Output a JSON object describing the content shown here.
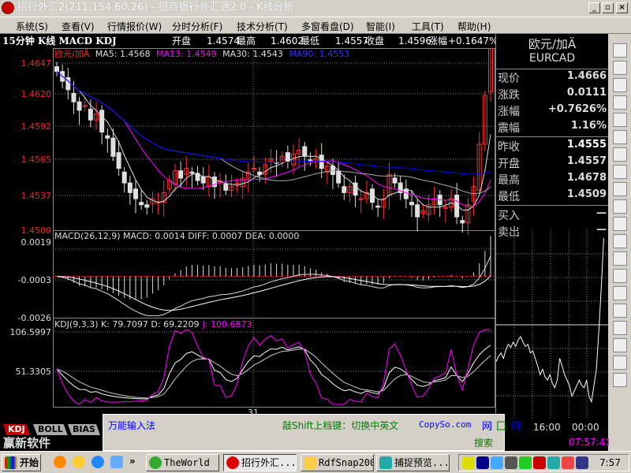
{
  "window": {
    "title": "招行外汇2(211.154.60.26) - 招商银行外汇通2.0 - K线分析",
    "min": "_",
    "restore": "▫",
    "close": "×"
  },
  "menu": [
    "系统(S)",
    "查看(V)",
    "行情报价(W)",
    "分时分析(F)",
    "技术分析(T)",
    "多窗看盘(D)",
    "智能(I)",
    "工具(T)",
    "帮助(H)"
  ],
  "info": {
    "title": "15分钟 K线 MACD KDJ",
    "open_label": "开盘",
    "open": "1.4574",
    "high_label": "最高",
    "high": "1.4602",
    "low_label": "最低",
    "low": "1.4557",
    "close_label": "收盘",
    "close": "1.4596",
    "chg_label": "涨幅",
    "chg": "+0.1647%"
  },
  "price_chart": {
    "name": "欧元/加Ä",
    "ma5": "MA5: 1.4568",
    "ma13": "MA13: 1.4549",
    "ma30": "MA30: 1.4543",
    "ma90": "MA90: 1.4553",
    "y_labels": [
      "1.4647",
      "1.4620",
      "1.4592",
      "1.4565",
      "1.4537",
      "1.4509"
    ],
    "ylim": [
      1.4509,
      1.4647
    ]
  },
  "macd": {
    "header": "MACD(26,12,9) MACD: 0.0014 DIFF: 0.0007 DEA: 0.0000",
    "y_labels": [
      "0.0019",
      "-0.0003",
      "-0.0026"
    ],
    "ylim": [
      -0.0026,
      0.0019
    ]
  },
  "kdj": {
    "header_k": "KDJ(9,3,3) K: 79.7097 D: 69.2209",
    "header_j": "J: 100.6873",
    "y_labels": [
      "106.5997",
      "51.3305"
    ]
  },
  "x_label": "31",
  "closes": [
    1.464,
    1.4632,
    1.4625,
    1.4615,
    1.4608,
    1.4612,
    1.46,
    1.4605,
    1.459,
    1.4585,
    1.457,
    1.456,
    1.4548,
    1.454,
    1.4535,
    1.453,
    1.4528,
    1.4535,
    1.4532,
    1.454,
    1.455,
    1.4558,
    1.4552,
    1.456,
    1.4556,
    1.455,
    1.4548,
    1.4553,
    1.4545,
    1.455,
    1.4542,
    1.4545,
    1.4548,
    1.4552,
    1.4557,
    1.456,
    1.4555,
    1.4563,
    1.4568,
    1.4565,
    1.457,
    1.4566,
    1.4572,
    1.4575,
    1.457,
    1.4566,
    1.4568,
    1.456,
    1.4562,
    1.4555,
    1.4548,
    1.454,
    1.4545,
    1.4538,
    1.4535,
    1.454,
    1.4532,
    1.4528,
    1.4535,
    1.4555,
    1.4548,
    1.454,
    1.4535,
    1.453,
    1.452,
    1.4525,
    1.453,
    1.4535,
    1.453,
    1.4528,
    1.4535,
    1.452,
    1.4515,
    1.453,
    1.4545,
    1.458,
    1.462,
    1.4666
  ],
  "quote": {
    "name": "欧元/加Ä",
    "code": "EURCAD",
    "rows": [
      {
        "l": "现价",
        "v": "1.4666"
      },
      {
        "l": "涨跌",
        "v": "0.0111"
      },
      {
        "l": "涨幅",
        "v": "+0.7626%"
      },
      {
        "l": "震幅",
        "v": "1.16%"
      },
      {
        "l": "昨收",
        "v": "1.4555"
      },
      {
        "l": "开盘",
        "v": "1.4557"
      },
      {
        "l": "最高",
        "v": "1.4678"
      },
      {
        "l": "最低",
        "v": "1.4509"
      },
      {
        "l": "买入",
        "v": "—"
      },
      {
        "l": "卖出",
        "v": "—"
      }
    ],
    "times": [
      "16:00",
      "00:00"
    ],
    "clock": "07:57:41"
  },
  "tabs": [
    "KDJ",
    "BOLL",
    "BIAS"
  ],
  "brand": "赢新软件",
  "ime": {
    "name": "万能输入法",
    "hint": "敲Shift上档键：切换中英文",
    "site": "CopySo.com",
    "b1": "网",
    "b2": "囗",
    "b3": "词",
    "search": "搜索"
  },
  "taskbar": {
    "start": "开始",
    "more": "»",
    "tasks": [
      "TheWorld",
      "招行外汇...",
      "RdfSnap2005",
      "捕捉预览..."
    ],
    "clock": "7:57"
  },
  "colors": {
    "up": "#ff3030",
    "down": "#e0e0e0",
    "ma13": "#ff00ff",
    "ma90": "#0000ff"
  }
}
